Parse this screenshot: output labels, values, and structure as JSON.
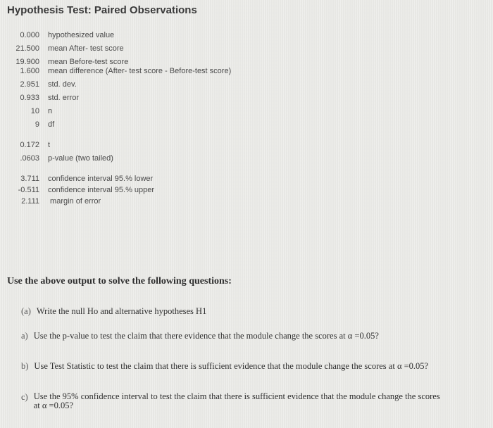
{
  "title": "Hypothesis Test: Paired Observations",
  "stats": [
    {
      "value": "0.000",
      "label": "hypothesized value"
    },
    {
      "value": "21.500",
      "label": "mean After- test score"
    },
    {
      "value": "19.900",
      "label": "mean Before-test score"
    },
    {
      "value": "1.600",
      "label": "mean difference  (After- test score - Before-test score)"
    },
    {
      "value": "2.951",
      "label": "std. dev."
    },
    {
      "value": "0.933",
      "label": "std. error"
    },
    {
      "value": "10",
      "label": "n"
    },
    {
      "value": "9",
      "label": "df"
    }
  ],
  "test_results": [
    {
      "value": "0.172",
      "label": "t"
    },
    {
      "value": ".0603",
      "label": "p-value (two tailed)"
    }
  ],
  "confidence": [
    {
      "value": "3.711",
      "label": "confidence interval 95.% lower"
    },
    {
      "value": "-0.511",
      "label": "confidence interval 95.% upper"
    },
    {
      "value": "2.111",
      "label": " margin of error"
    }
  ],
  "instructions": "Use the above output to solve the following questions:",
  "questions": [
    {
      "label": "(a)",
      "text": "Write the null Ho and alternative hypotheses H1"
    },
    {
      "label": "a)",
      "text": "Use the p-value to test the claim that there evidence that the module change the scores at α =0.05?"
    },
    {
      "label": "b)",
      "text": "Use Test Statistic to test the claim that there is sufficient evidence that the module change the scores at α =0.05?"
    },
    {
      "label": "c)",
      "text": "Use the 95% confidence interval to test the claim that there is sufficient evidence that the module change the scores at α =0.05?"
    }
  ]
}
